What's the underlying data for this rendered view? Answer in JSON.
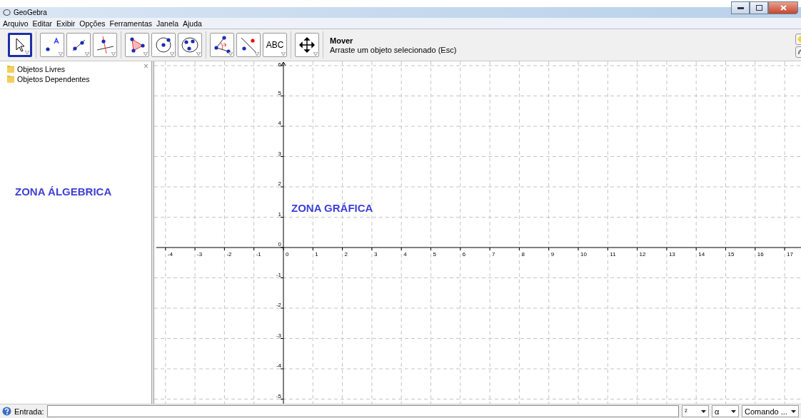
{
  "window": {
    "title": "GeoGebra"
  },
  "menu": [
    "Arquivo",
    "Editar",
    "Exibir",
    "Opções",
    "Ferramentas",
    "Janela",
    "Ajuda"
  ],
  "tool_groups": [
    [
      {
        "kind": "move",
        "selected": true
      }
    ],
    [
      {
        "kind": "point",
        "selected": false
      },
      {
        "kind": "line",
        "selected": false
      },
      {
        "kind": "perpendicular",
        "selected": false
      }
    ],
    [
      {
        "kind": "polygon",
        "selected": false
      },
      {
        "kind": "circle",
        "selected": false
      },
      {
        "kind": "conic",
        "selected": false
      }
    ],
    [
      {
        "kind": "angle",
        "selected": false
      },
      {
        "kind": "reflect",
        "selected": false
      },
      {
        "kind": "text",
        "selected": false,
        "label": "ABC"
      }
    ],
    [
      {
        "kind": "move_view",
        "selected": false
      }
    ]
  ],
  "tool_help": {
    "name": "Mover",
    "description": "Arraste um objeto selecionado (Esc)"
  },
  "algebra": {
    "items": [
      "Objetos Livres",
      "Objetos Dependentes"
    ],
    "close": "×",
    "caption": "ZONA ÁLGEBRICA"
  },
  "graphics": {
    "caption": "ZONA GRÁFICA",
    "x_ticks": [
      "-4",
      "-3",
      "-2",
      "-1",
      "0",
      "1",
      "2",
      "3",
      "4",
      "5",
      "6",
      "7",
      "8",
      "9",
      "10",
      "11",
      "12",
      "13",
      "14",
      "15",
      "16",
      "17"
    ],
    "y_ticks": [
      "6",
      "5",
      "4",
      "3",
      "2",
      "1",
      "0",
      "-1",
      "-2",
      "-3",
      "-4",
      "-5"
    ]
  },
  "input_bar": {
    "label": "Entrada:",
    "selectors": [
      "²",
      "α",
      "Comando ..."
    ]
  }
}
